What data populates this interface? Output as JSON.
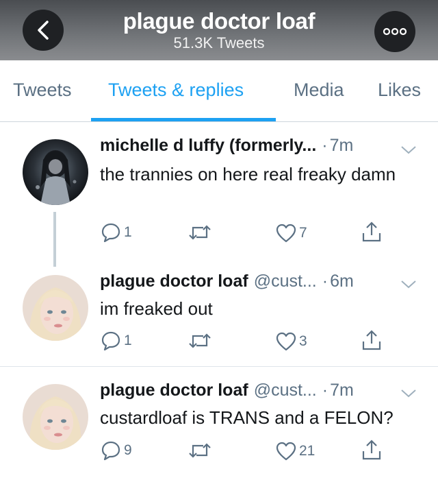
{
  "header": {
    "title": "plague doctor loaf",
    "subtitle": "51.3K Tweets",
    "back_icon": "chevron-left-icon",
    "more_icon": "more-dots-icon"
  },
  "tabs": [
    {
      "label": "Tweets"
    },
    {
      "label": "Tweets & replies",
      "active": true
    },
    {
      "label": "Media"
    },
    {
      "label": "Likes"
    }
  ],
  "colors": {
    "accent": "#1da1f2",
    "secondary_text": "#5b7083"
  },
  "tweets": [
    {
      "name": "michelle d luffy (formerly...",
      "handle": "",
      "time": "7m",
      "text": "the trannies on here real freaky damn",
      "replies": "1",
      "retweets": "",
      "likes": "7"
    },
    {
      "name": "plague doctor loaf",
      "handle": "@cust...",
      "time": "6m",
      "text": "im freaked out",
      "replies": "1",
      "retweets": "",
      "likes": "3"
    },
    {
      "name": "plague doctor loaf",
      "handle": "@cust...",
      "time": "7m",
      "text": "custardloaf is TRANS and a FELON?",
      "replies": "9",
      "retweets": "",
      "likes": "21"
    }
  ]
}
